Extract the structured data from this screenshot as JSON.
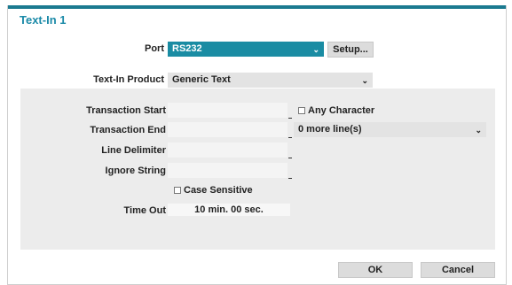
{
  "dialog": {
    "title": "Text-In 1"
  },
  "port": {
    "label": "Port",
    "value": "RS232",
    "setup_label": "Setup..."
  },
  "product": {
    "label": "Text-In Product",
    "value": "Generic Text"
  },
  "transaction_start": {
    "label": "Transaction Start",
    "value": "",
    "any_character_label": "Any Character",
    "any_character_checked": false
  },
  "transaction_end": {
    "label": "Transaction End",
    "value": "",
    "more_lines_value": "0 more line(s)"
  },
  "line_delimiter": {
    "label": "Line Delimiter",
    "value": ""
  },
  "ignore_string": {
    "label": "Ignore String",
    "value": ""
  },
  "case_sensitive": {
    "label": "Case Sensitive",
    "checked": false
  },
  "time_out": {
    "label": "Time Out",
    "value": "10 min. 00 sec."
  },
  "footer": {
    "ok_label": "OK",
    "cancel_label": "Cancel"
  },
  "colors": {
    "accent": "#1a8ca3",
    "title": "#1b8aa8",
    "panel": "#ececec"
  }
}
